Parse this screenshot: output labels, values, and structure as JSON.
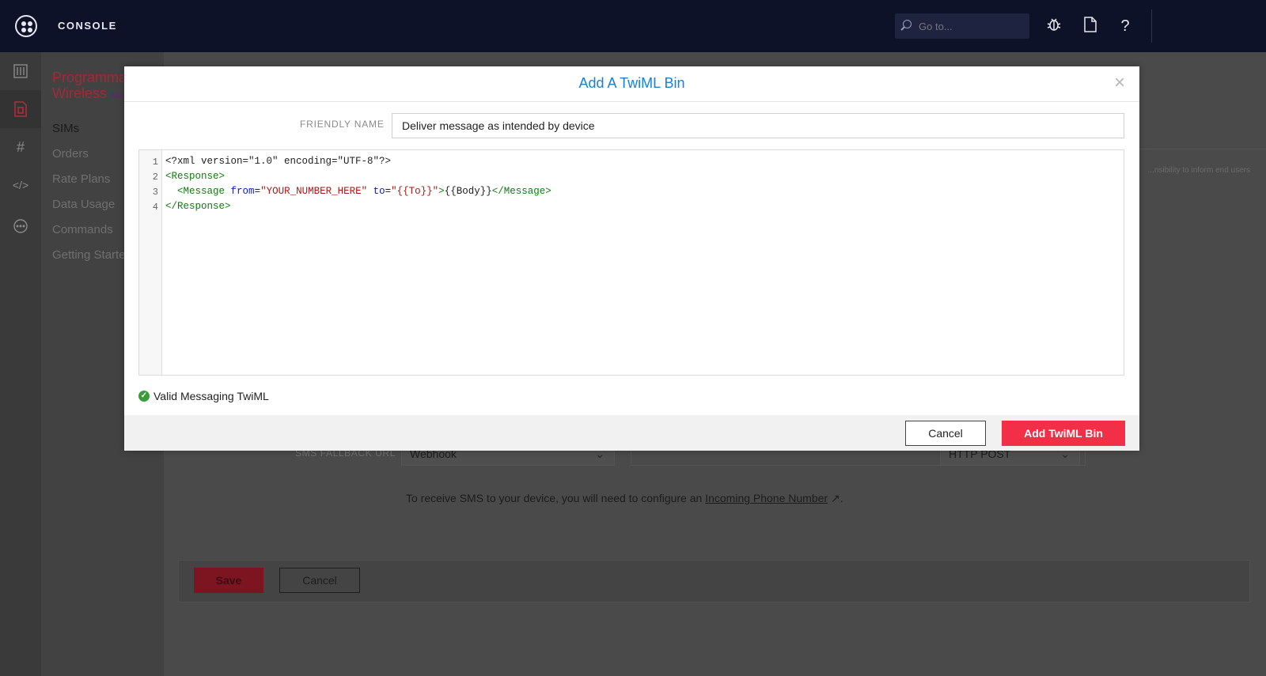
{
  "topbar": {
    "console_label": "CONSOLE",
    "search_placeholder": "Go to...",
    "icons": [
      "debugger-icon",
      "docs-icon",
      "help-icon"
    ],
    "help_glyph": "?"
  },
  "rail": {
    "icons": [
      "dashboard-icon",
      "sim-icon",
      "hash-icon",
      "code-icon",
      "more-icon"
    ],
    "hash_glyph": "#",
    "code_glyph": "</>",
    "more_glyph": "···"
  },
  "sidebar": {
    "title_line1": "Programmable",
    "title_line2": "Wireless",
    "beta": "Beta",
    "items": [
      {
        "label": "SIMs"
      },
      {
        "label": "Orders"
      },
      {
        "label": "Rate Plans"
      },
      {
        "label": "Data Usage"
      },
      {
        "label": "Commands"
      },
      {
        "label": "Getting Started"
      }
    ]
  },
  "main": {
    "right_snippet": "...nsibility to inform end users",
    "sms_fallback_label": "SMS FALLBACK URL",
    "fallback_type": "Webhook",
    "fallback_method": "HTTP POST",
    "info_prefix": "To receive SMS to your device, you will need to configure an ",
    "info_link": "Incoming Phone Number",
    "info_suffix": " ↗.",
    "save_label": "Save",
    "cancel_label": "Cancel"
  },
  "modal": {
    "title": "Add A TwiML Bin",
    "close_glyph": "×",
    "friendly_name_label": "FRIENDLY NAME",
    "friendly_name_value": "Deliver message as intended by device",
    "code": {
      "line_numbers": [
        "1",
        "2",
        "3",
        "4"
      ],
      "line1": "<?xml version=\"1.0\" encoding=\"UTF-8\"?>",
      "response_open": "<Response>",
      "message_open": "<Message",
      "from_attr": "from",
      "eq": "=",
      "from_val": "\"YOUR_NUMBER_HERE\"",
      "to_attr": "to",
      "to_val": "\"{{To}}\"",
      "gt": ">",
      "body": "{{Body}}",
      "message_close": "</Message>",
      "response_close": "</Response>"
    },
    "valid_text": "Valid Messaging TwiML",
    "cancel_label": "Cancel",
    "add_label": "Add TwiML Bin"
  },
  "colors": {
    "accent_blue": "#1383d8",
    "brand_red": "#f22f46",
    "valid_green": "#3b9c3b",
    "topbar_bg": "#0d1229"
  }
}
